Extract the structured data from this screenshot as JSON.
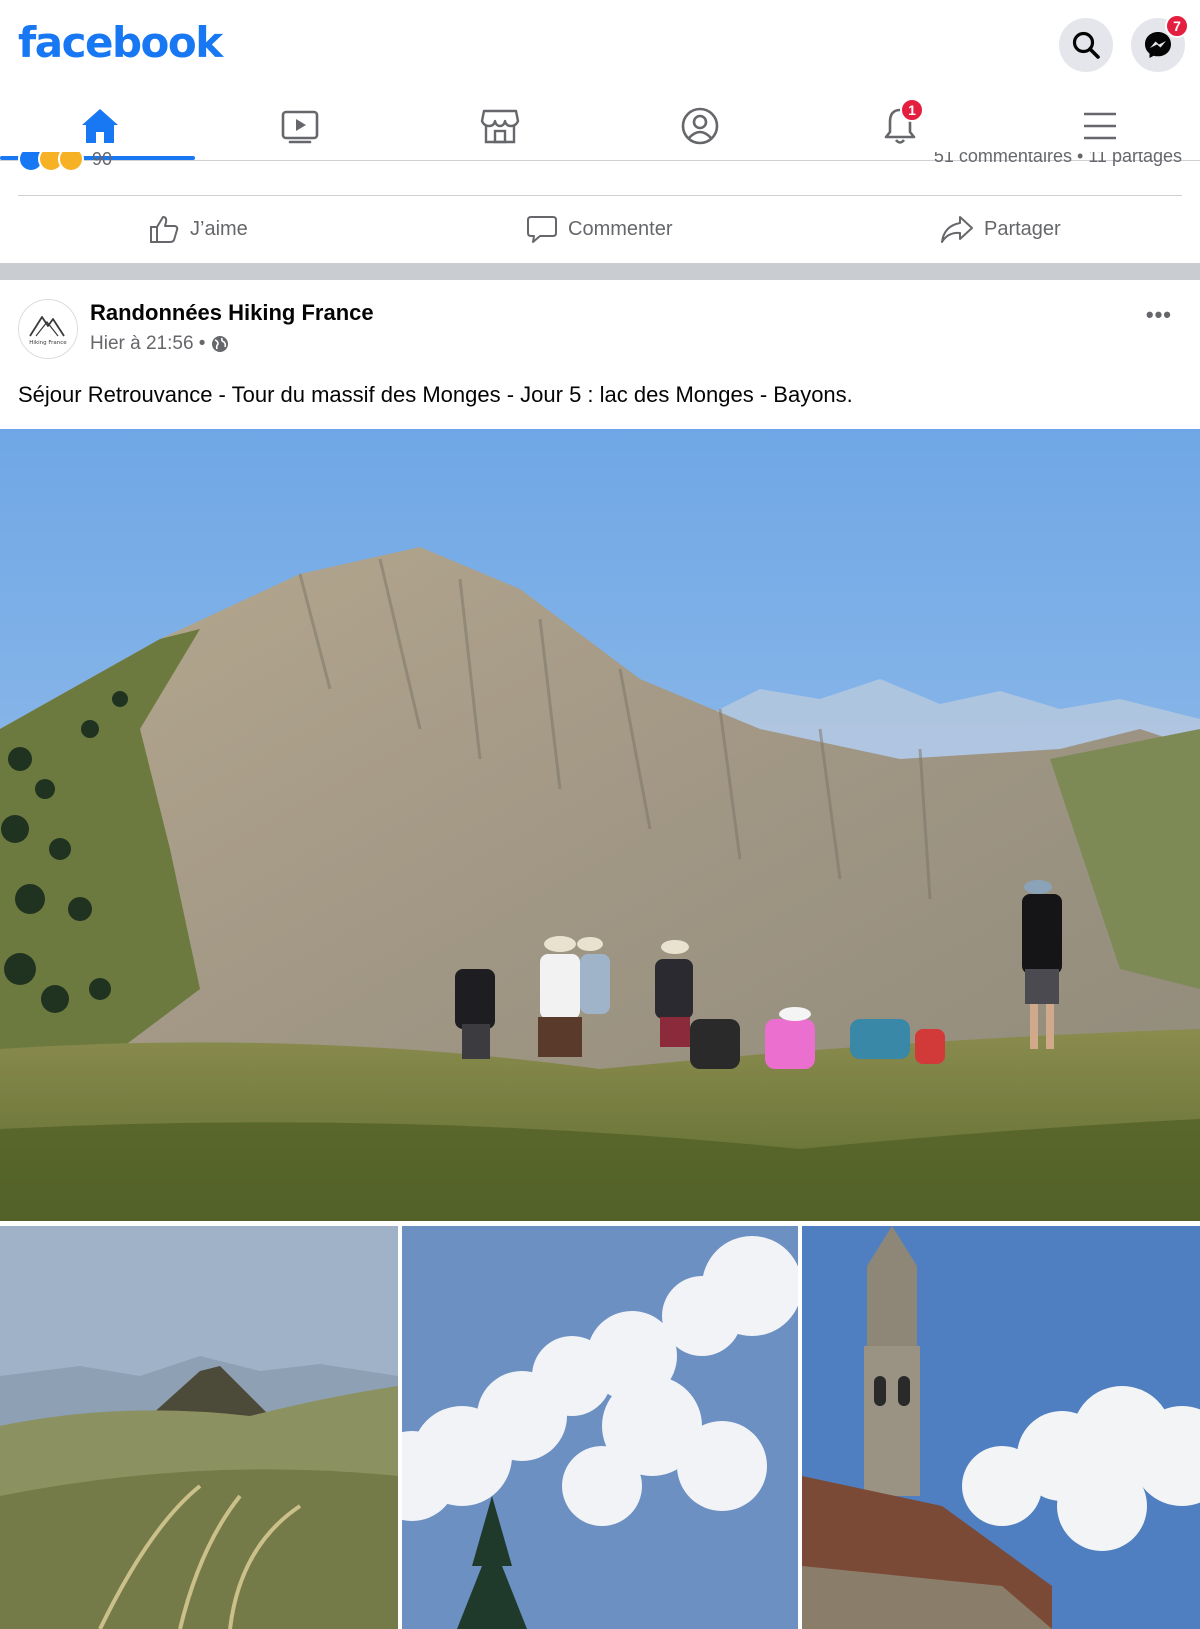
{
  "app": {
    "brand": "facebook",
    "brand_color": "#1877f2",
    "messenger_badge": "7",
    "notifications_badge": "1"
  },
  "nav": {
    "tabs": [
      {
        "name": "home",
        "icon": "home-icon",
        "active": true
      },
      {
        "name": "watch",
        "icon": "video-icon",
        "active": false
      },
      {
        "name": "marketplace",
        "icon": "marketplace-icon",
        "active": false
      },
      {
        "name": "profile",
        "icon": "profile-icon",
        "active": false
      },
      {
        "name": "notifications",
        "icon": "bell-icon",
        "active": false
      },
      {
        "name": "menu",
        "icon": "menu-icon",
        "active": false
      }
    ]
  },
  "previous_post": {
    "reaction_count": "90",
    "comments_shares": "51 commentaires • 11 partages",
    "actions": {
      "like": "J’aime",
      "comment": "Commenter",
      "share": "Partager"
    }
  },
  "post": {
    "page_name": "Randonnées Hiking France",
    "timestamp": "Hier à 21:56 •",
    "audience_icon": "globe-icon",
    "avatar_text": "Hiking France",
    "text": "Séjour Retrouvance - Tour du massif des Monges - Jour 5 : lac des Monges - Bayons.",
    "photos": [
      {
        "description": "hikers-on-ridge-photo"
      },
      {
        "description": "mountain-hills-photo"
      },
      {
        "description": "clouds-tree-photo"
      },
      {
        "description": "church-bell-tower-photo"
      }
    ]
  }
}
